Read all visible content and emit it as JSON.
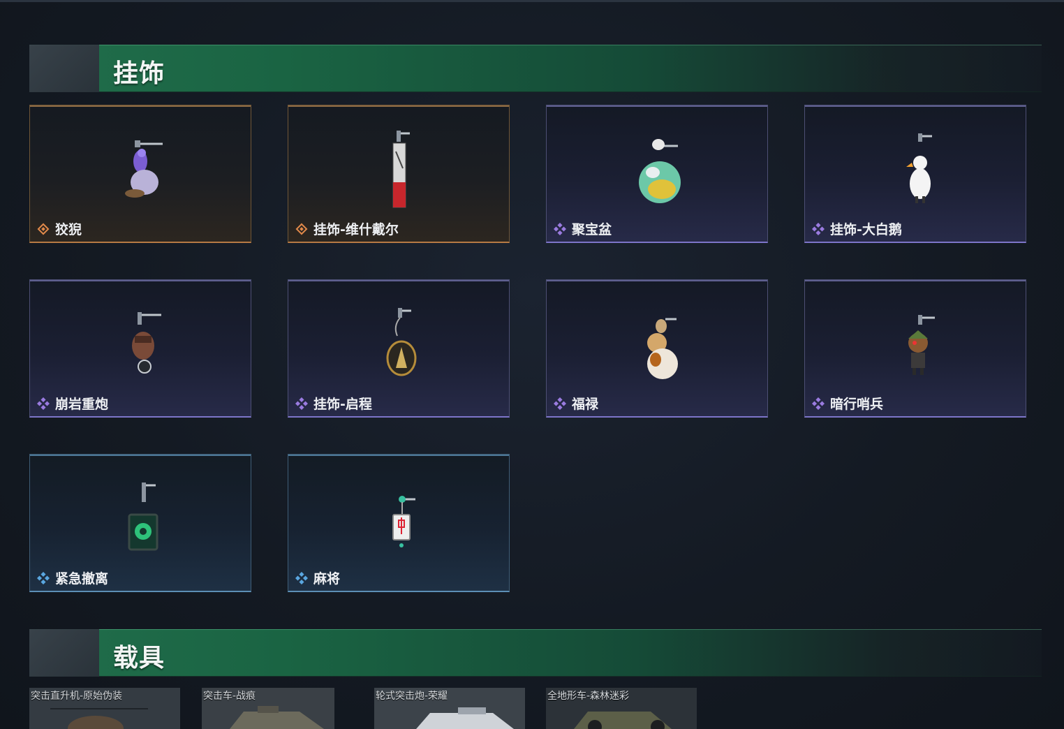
{
  "sections": {
    "charms": {
      "title": "挂饰"
    },
    "vehicles": {
      "title": "载具"
    }
  },
  "charms": [
    {
      "name": "狡猊",
      "rarity": "gold"
    },
    {
      "name": "挂饰-维什戴尔",
      "rarity": "gold"
    },
    {
      "name": "聚宝盆",
      "rarity": "purple"
    },
    {
      "name": "挂饰-大白鹅",
      "rarity": "purple"
    },
    {
      "name": "崩岩重炮",
      "rarity": "purple"
    },
    {
      "name": "挂饰-启程",
      "rarity": "purple"
    },
    {
      "name": "福禄",
      "rarity": "purple"
    },
    {
      "name": "暗行哨兵",
      "rarity": "purple"
    },
    {
      "name": "紧急撤离",
      "rarity": "blue"
    },
    {
      "name": "麻将",
      "rarity": "blue"
    }
  ],
  "vehicles": [
    {
      "name": "突击直升机-原始伪装"
    },
    {
      "name": "突击车-战痕"
    },
    {
      "name": "轮式突击炮-荣耀"
    },
    {
      "name": "全地形车-森林迷彩"
    }
  ],
  "colors": {
    "gold": "#e1894a",
    "purple": "#9a7be0",
    "blue": "#5aa7e0",
    "header_green": "#1f6b49"
  }
}
